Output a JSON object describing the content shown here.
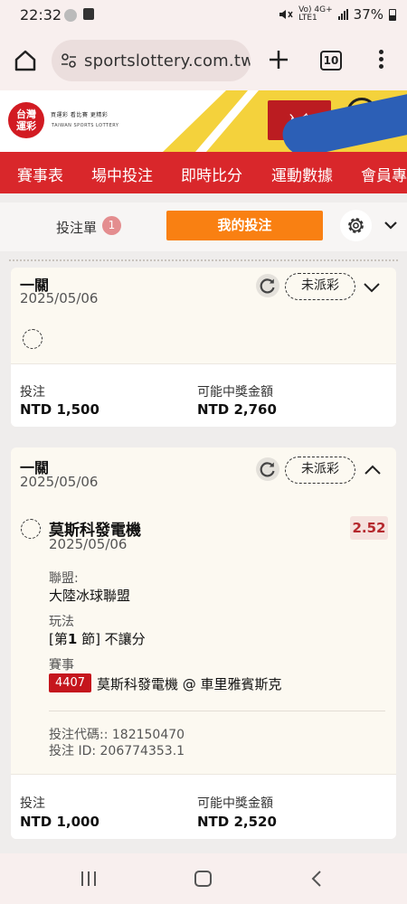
{
  "status_bar": {
    "time": "22:32",
    "network": "Vo) 4G+",
    "network_sub": "LTE1",
    "battery": "37%"
  },
  "browser": {
    "url": "sportslottery.com.tw",
    "tab_count": "10"
  },
  "site": {
    "logo_text": "台灣\n運彩",
    "logo_tags": "買運彩  看比賽  更精彩",
    "logo_en": "TAIWAN SPORTS LOTTERY",
    "deposit_label": "入金"
  },
  "nav": {
    "items": [
      "賽事表",
      "場中投注",
      "即時比分",
      "運動數據",
      "會員專"
    ]
  },
  "bet_panel": {
    "betslip_label": "投注單",
    "betslip_count": "1",
    "my_bets_label": "我的投注"
  },
  "bets": [
    {
      "type": "一關",
      "date": "2025/05/06",
      "status": "未派彩",
      "stake_label": "投注",
      "stake": "NTD 1,500",
      "payout_label": "可能中獎金額",
      "payout": "NTD 2,760"
    },
    {
      "type": "一關",
      "date": "2025/05/06",
      "status": "未派彩",
      "selection": "莫斯科發電機",
      "selection_date": "2025/05/06",
      "odds": "2.52",
      "league_label": "聯盟:",
      "league": "大陸冰球聯盟",
      "market_label": "玩法",
      "market_prefix": "[第",
      "market_num": "1",
      "market_suffix": " 節] 不讓分",
      "event_label": "賽事",
      "event_id": "4407",
      "event_name": "莫斯科發電機 @ 車里雅賓斯克",
      "bet_code": "投注代碼:: 182150470",
      "bet_id": "投注 ID: 206774353.1",
      "stake_label": "投注",
      "stake": "NTD 1,000",
      "payout_label": "可能中獎金額",
      "payout": "NTD 2,520"
    }
  ]
}
